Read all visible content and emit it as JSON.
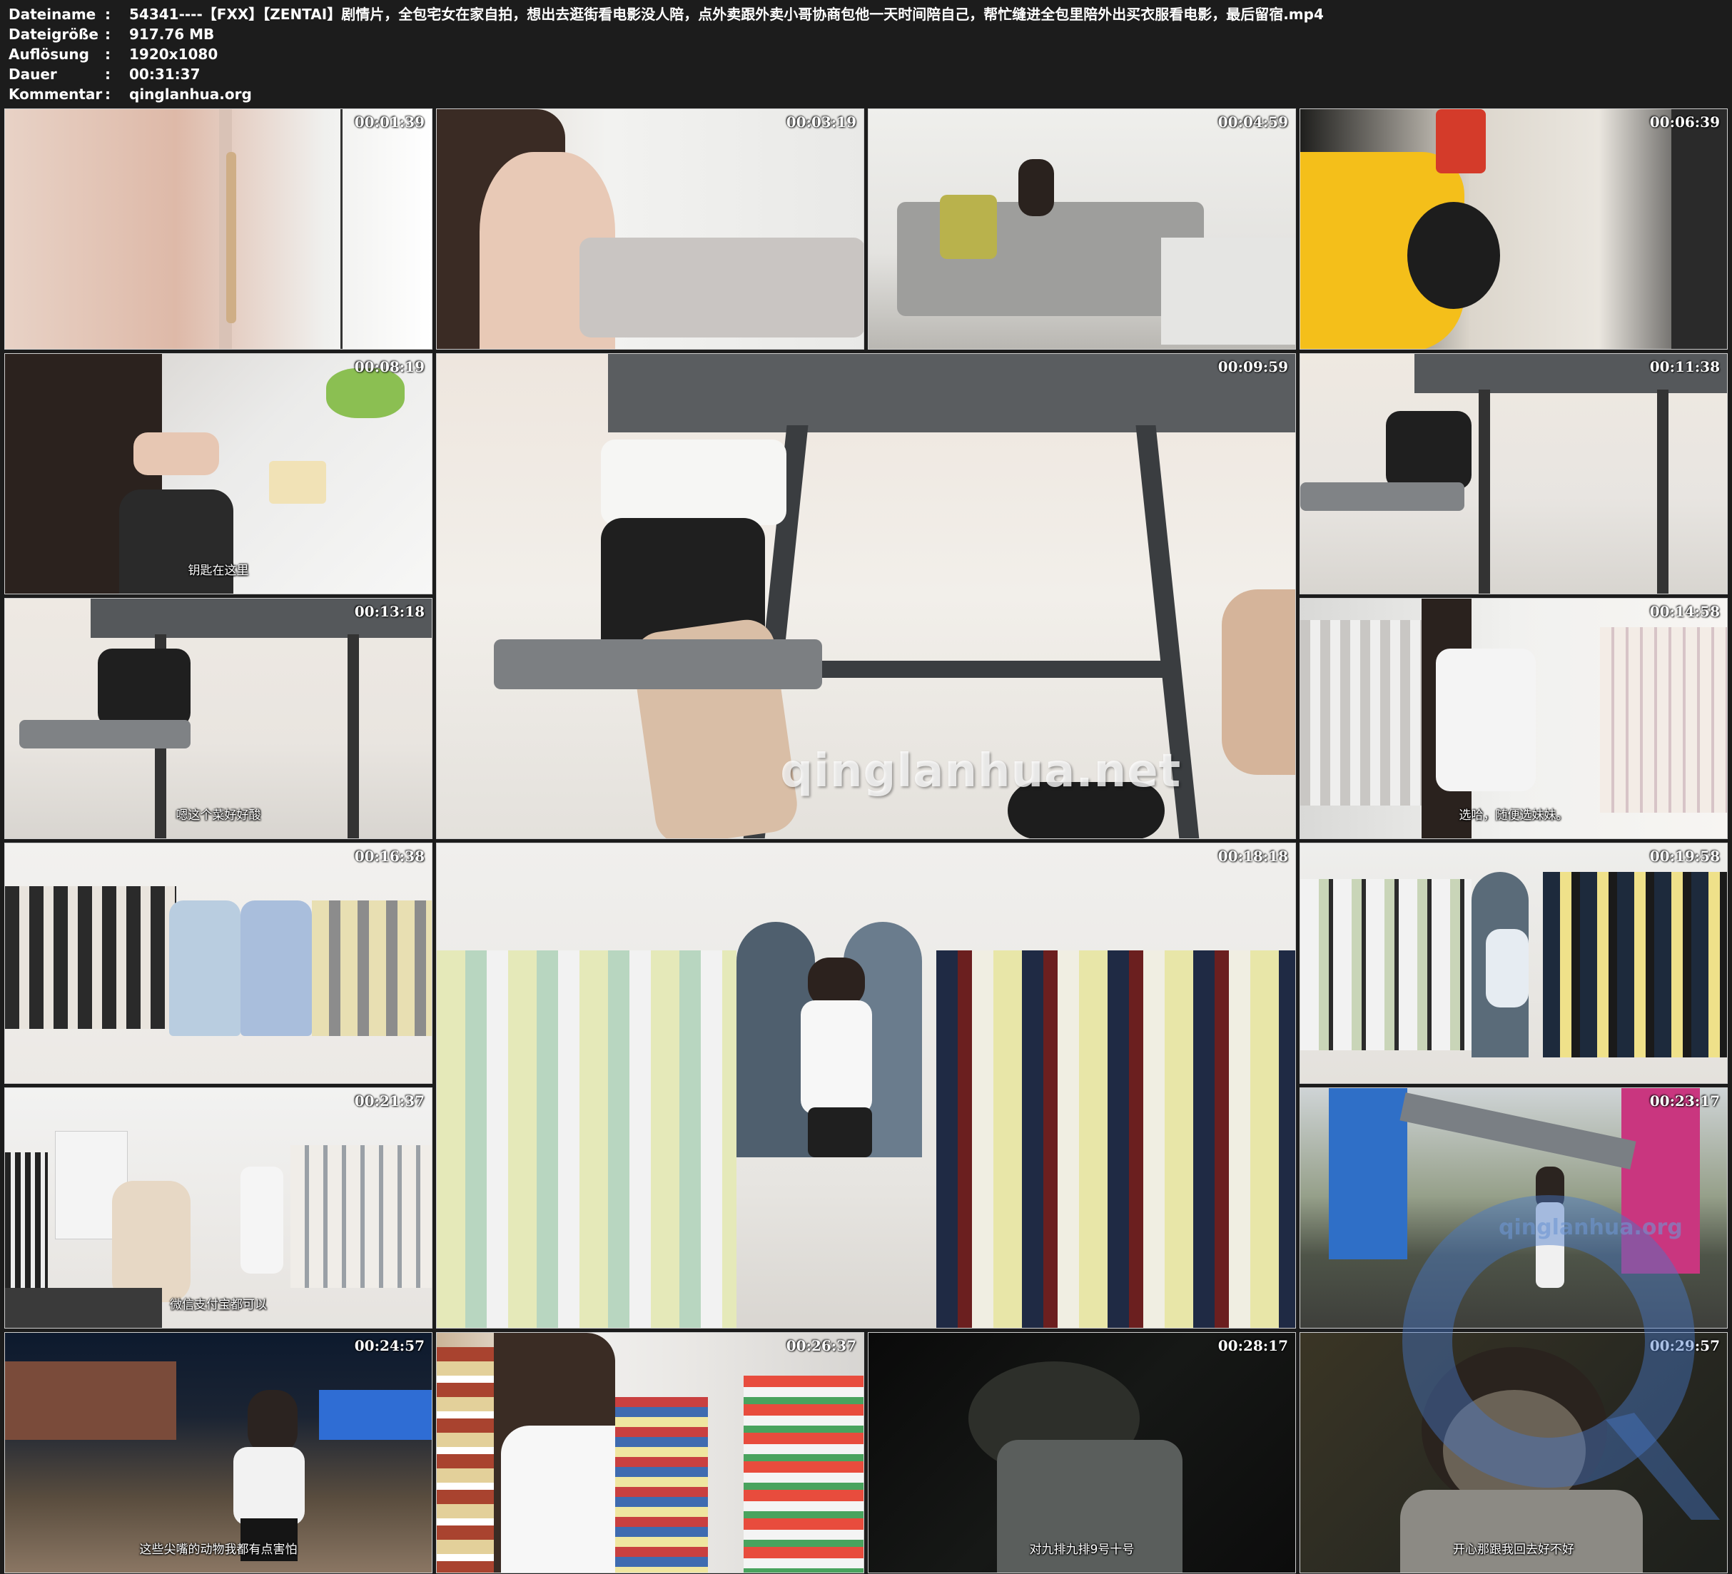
{
  "meta": {
    "rows": [
      {
        "key": "Dateiname",
        "sep": ":",
        "value": "54341----【FXX】【ZENTAI】剧情片，全包宅女在家自拍，想出去逛街看电影没人陪，点外卖跟外卖小哥协商包他一天时间陪自己，帮忙缝进全包里陪外出买衣服看电影，最后留宿.mp4"
      },
      {
        "key": "Dateigröße",
        "sep": ":",
        "value": "917.76 MB"
      },
      {
        "key": "Auflösung",
        "sep": ":",
        "value": "1920x1080"
      },
      {
        "key": "Dauer",
        "sep": ":",
        "value": "00:31:37"
      },
      {
        "key": "Kommentar",
        "sep": ":",
        "value": "qinglanhua.org"
      }
    ]
  },
  "thumbnails": [
    {
      "time": "00:01:39",
      "subtitle": ""
    },
    {
      "time": "00:03:19",
      "subtitle": ""
    },
    {
      "time": "00:04:59",
      "subtitle": ""
    },
    {
      "time": "00:06:39",
      "subtitle": ""
    },
    {
      "time": "00:08:19",
      "subtitle": "钥匙在这里"
    },
    {
      "time": "00:09:59",
      "subtitle": ""
    },
    {
      "time": "00:11:38",
      "subtitle": ""
    },
    {
      "time": "00:13:18",
      "subtitle": "嗯这个菜好好酸"
    },
    {
      "time": "00:14:58",
      "subtitle": "选哈，随便选妹妹。"
    },
    {
      "time": "00:16:38",
      "subtitle": ""
    },
    {
      "time": "00:18:18",
      "subtitle": ""
    },
    {
      "time": "00:19:58",
      "subtitle": ""
    },
    {
      "time": "00:21:37",
      "subtitle": "微信支付宝都可以"
    },
    {
      "time": "00:23:17",
      "subtitle": ""
    },
    {
      "time": "00:24:57",
      "subtitle": "这些尖嘴的动物我都有点害怕"
    },
    {
      "time": "00:26:37",
      "subtitle": ""
    },
    {
      "time": "00:28:17",
      "subtitle": "对九排九排9号十号"
    },
    {
      "time": "00:29:57",
      "subtitle": "开心那跟我回去好不好"
    }
  ],
  "watermarks": {
    "center_large": "qinglanhua.net",
    "corner_logo": "qinglanhua.org"
  },
  "colors": {
    "background": "#1c1c1c",
    "header_text": "#ffffff"
  }
}
